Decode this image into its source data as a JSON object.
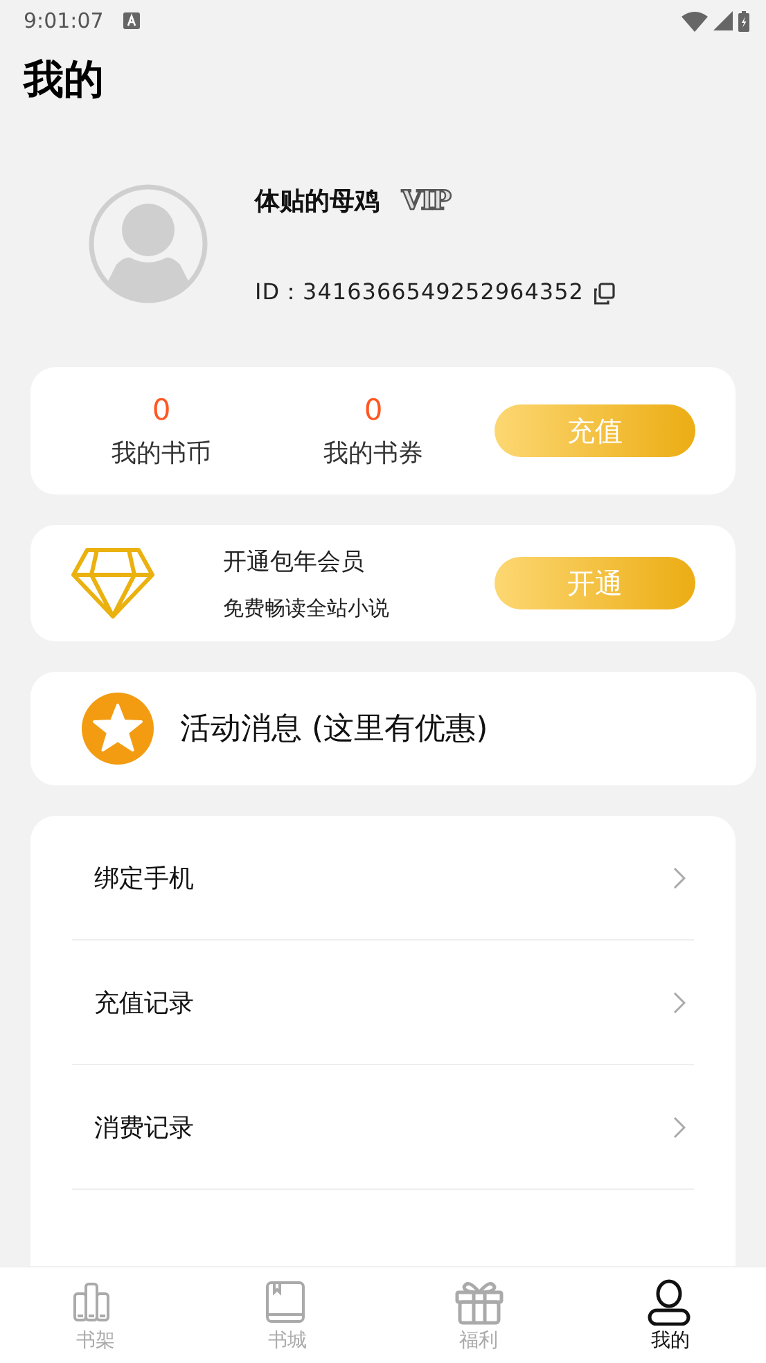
{
  "status_bar": {
    "time": "9:01:07"
  },
  "header": {
    "title": "我的"
  },
  "profile": {
    "name": "体贴的母鸡",
    "badge": "VIP",
    "id_text": "ID：3416366549252964352"
  },
  "wallet": {
    "stats": [
      {
        "value": "0",
        "label": "我的书币"
      },
      {
        "value": "0",
        "label": "我的书券"
      }
    ],
    "button": "充值"
  },
  "membership": {
    "title": "开通包年会员",
    "subtitle": "免费畅读全站小说",
    "button": "开通"
  },
  "promo": {
    "label": "活动消息 (这里有优惠)"
  },
  "menu": {
    "items": [
      {
        "label": "绑定手机"
      },
      {
        "label": "充值记录"
      },
      {
        "label": "消费记录"
      }
    ]
  },
  "tab_bar": {
    "tabs": [
      {
        "label": "书架",
        "kind": "shelf",
        "selected": false
      },
      {
        "label": "书城",
        "kind": "book",
        "selected": false
      },
      {
        "label": "福利",
        "kind": "gift",
        "selected": false
      },
      {
        "label": "我的",
        "kind": "person",
        "selected": true
      }
    ]
  }
}
